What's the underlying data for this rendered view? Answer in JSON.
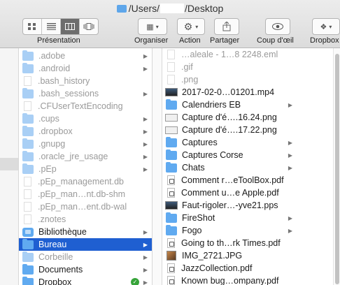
{
  "window": {
    "title_prefix": "/Users/",
    "title_suffix": "/Desktop"
  },
  "toolbar": {
    "presentation_label": "Présentation",
    "organiser_label": "Organiser",
    "action_label": "Action",
    "share_label": "Partager",
    "quicklook_label": "Coup d'œil",
    "dropbox_label": "Dropbox",
    "view_icons": [
      "icon-view-icon",
      "list-view-icon",
      "column-view-icon",
      "cover-flow-icon"
    ],
    "active_view": 2
  },
  "middle_column": {
    "items": [
      {
        "name": ".adobe",
        "kind": "folder",
        "dim": true,
        "arrow": true
      },
      {
        "name": ".android",
        "kind": "folder",
        "dim": true,
        "arrow": true
      },
      {
        "name": ".bash_history",
        "kind": "doc",
        "dim": true,
        "arrow": false
      },
      {
        "name": ".bash_sessions",
        "kind": "folder",
        "dim": true,
        "arrow": true
      },
      {
        "name": ".CFUserTextEncoding",
        "kind": "doc",
        "dim": true,
        "arrow": false
      },
      {
        "name": ".cups",
        "kind": "folder",
        "dim": true,
        "arrow": true
      },
      {
        "name": ".dropbox",
        "kind": "folder",
        "dim": true,
        "arrow": true
      },
      {
        "name": ".gnupg",
        "kind": "folder",
        "dim": true,
        "arrow": true
      },
      {
        "name": ".oracle_jre_usage",
        "kind": "folder",
        "dim": true,
        "arrow": true
      },
      {
        "name": ".pEp",
        "kind": "folder",
        "dim": true,
        "arrow": true
      },
      {
        "name": ".pEp_management.db",
        "kind": "doc",
        "dim": true,
        "arrow": false
      },
      {
        "name": ".pEp_man…nt.db-shm",
        "kind": "doc",
        "dim": true,
        "arrow": false
      },
      {
        "name": ".pEp_man…ent.db-wal",
        "kind": "doc",
        "dim": true,
        "arrow": false
      },
      {
        "name": ".znotes",
        "kind": "doc",
        "dim": true,
        "arrow": false
      },
      {
        "name": "Bibliothèque",
        "kind": "app",
        "dim": false,
        "arrow": true
      },
      {
        "name": "Bureau",
        "kind": "folder",
        "dim": false,
        "arrow": true,
        "selected": true
      },
      {
        "name": "Corbeille",
        "kind": "folder",
        "dim": true,
        "arrow": true
      },
      {
        "name": "Documents",
        "kind": "folder",
        "dim": false,
        "arrow": true
      },
      {
        "name": "Dropbox",
        "kind": "folder",
        "dim": false,
        "arrow": true,
        "badge": "✓"
      }
    ]
  },
  "right_column": {
    "items": [
      {
        "name": "…aleale - 1…8 2248.eml",
        "kind": "doc",
        "dim": true,
        "arrow": false
      },
      {
        "name": ".gif",
        "kind": "doc",
        "dim": true,
        "arrow": false
      },
      {
        "name": ".png",
        "kind": "doc",
        "dim": true,
        "arrow": false
      },
      {
        "name": "2017-02-0…01201.mp4",
        "kind": "img",
        "dim": false,
        "arrow": false
      },
      {
        "name": "Calendriers EB",
        "kind": "folder",
        "dim": false,
        "arrow": true
      },
      {
        "name": "Capture d'é….16.24.png",
        "kind": "png",
        "dim": false,
        "arrow": false
      },
      {
        "name": "Capture d'é….17.22.png",
        "kind": "png",
        "dim": false,
        "arrow": false
      },
      {
        "name": "Captures",
        "kind": "folder",
        "dim": false,
        "arrow": true
      },
      {
        "name": "Captures Corse",
        "kind": "folder",
        "dim": false,
        "arrow": true
      },
      {
        "name": "Chats",
        "kind": "folder",
        "dim": false,
        "arrow": true
      },
      {
        "name": "Comment r…eToolBox.pdf",
        "kind": "pdf",
        "dim": false,
        "arrow": false
      },
      {
        "name": "Comment u…e Apple.pdf",
        "kind": "pdf",
        "dim": false,
        "arrow": false
      },
      {
        "name": "Faut-rigoler…-yve21.pps",
        "kind": "img",
        "dim": false,
        "arrow": false
      },
      {
        "name": "FireShot",
        "kind": "folder",
        "dim": false,
        "arrow": true
      },
      {
        "name": "Fogo",
        "kind": "folder",
        "dim": false,
        "arrow": true
      },
      {
        "name": "Going to th…rk Times.pdf",
        "kind": "pdf",
        "dim": false,
        "arrow": false
      },
      {
        "name": "IMG_2721.JPG",
        "kind": "jpg",
        "dim": false,
        "arrow": false
      },
      {
        "name": "JazzCollection.pdf",
        "kind": "pdf",
        "dim": false,
        "arrow": false
      },
      {
        "name": "Known bug…ompany.pdf",
        "kind": "pdf",
        "dim": false,
        "arrow": false
      }
    ]
  },
  "colors": {
    "selection": "#1f5fd1",
    "folder": "#60aaf0",
    "dim_text": "#9a9a9a"
  }
}
